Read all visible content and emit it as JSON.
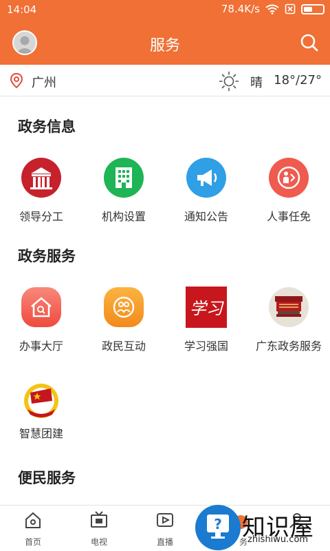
{
  "status": {
    "time": "14:04",
    "speed": "78.4K/s"
  },
  "header": {
    "title": "服务"
  },
  "location": {
    "city": "广州",
    "weather": "晴",
    "temperature": "18°/27°"
  },
  "sections": {
    "gov_info": {
      "title": "政务信息",
      "items": [
        {
          "label": "领导分工",
          "icon": "building-gate-icon",
          "color": "#c6222b"
        },
        {
          "label": "机构设置",
          "icon": "office-building-icon",
          "color": "#1fb455"
        },
        {
          "label": "通知公告",
          "icon": "megaphone-icon",
          "color": "#2f9fe6"
        },
        {
          "label": "人事任免",
          "icon": "person-swap-icon",
          "color": "#ef5b4f"
        }
      ]
    },
    "gov_service": {
      "title": "政务服务",
      "items": [
        {
          "label": "办事大厅",
          "icon": "hall-icon",
          "color": "#f15a4d"
        },
        {
          "label": "政民互动",
          "icon": "interaction-icon",
          "color": "#f39a24"
        },
        {
          "label": "学习强国",
          "icon": "xuexi-logo-icon",
          "color": "#c8161d"
        },
        {
          "label": "广东政务服务",
          "icon": "guangdong-service-logo-icon",
          "color": "#b51b1b"
        },
        {
          "label": "智慧团建",
          "icon": "youth-league-emblem-icon",
          "color": "#c5161d"
        }
      ]
    },
    "people_service": {
      "title": "便民服务"
    }
  },
  "bottom_nav": {
    "items": [
      {
        "label": "首页",
        "icon": "home-icon"
      },
      {
        "label": "电视",
        "icon": "tv-icon"
      },
      {
        "label": "直播",
        "icon": "live-icon"
      },
      {
        "label": "务",
        "icon": "service-icon"
      },
      {
        "label": "",
        "icon": "user-icon"
      }
    ]
  },
  "watermark": {
    "text": "知识屋",
    "url": "zhishiwu.com"
  },
  "colors": {
    "brand": "#f07035"
  }
}
